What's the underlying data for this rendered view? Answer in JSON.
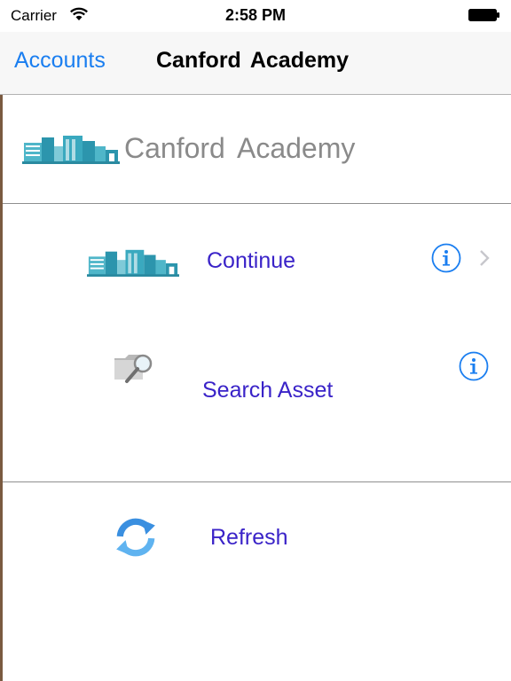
{
  "status_bar": {
    "carrier": "Carrier",
    "time": "2:58 PM"
  },
  "nav_bar": {
    "back_label": "Accounts",
    "title": "Canford  Academy"
  },
  "header": {
    "title": "Canford  Academy",
    "icon": "school-building-icon"
  },
  "menu": {
    "items": [
      {
        "label": "Continue",
        "icon": "school-building-icon",
        "has_info": true,
        "has_chevron": true
      },
      {
        "label": "Search Asset",
        "icon": "folder-search-icon",
        "has_info": true,
        "has_chevron": false
      },
      {
        "label": "Refresh",
        "icon": "refresh-icon",
        "has_info": false,
        "has_chevron": false
      }
    ]
  },
  "colors": {
    "accent": "#1a7ef0",
    "label": "#3a23c8",
    "header_text": "#8a8a8a",
    "building": "#3aa9bf"
  }
}
